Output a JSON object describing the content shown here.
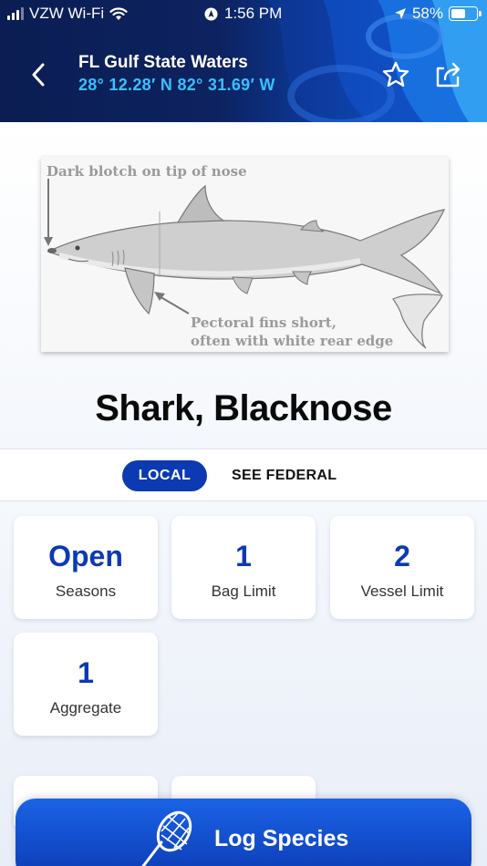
{
  "status_bar": {
    "carrier": "VZW Wi-Fi",
    "time": "1:56 PM",
    "battery": "58%",
    "battery_level": 0.58,
    "icons": [
      "signal-icon",
      "wifi-icon",
      "location-circle-icon",
      "location-arrow-icon",
      "battery-icon"
    ]
  },
  "header": {
    "title": "FL Gulf State Waters",
    "coordinates": "28° 12.28′ N 82° 31.69′ W",
    "icons": [
      "back-icon",
      "star-icon",
      "share-icon"
    ]
  },
  "species_image": {
    "label_nose": "Dark blotch on tip of nose",
    "label_fins_line1": "Pectoral fins short,",
    "label_fins_line2": "often with white rear edge"
  },
  "species": {
    "name": "Shark, Blacknose"
  },
  "tabs": {
    "local": "LOCAL",
    "federal": "SEE FEDERAL",
    "active": "LOCAL"
  },
  "cards": [
    {
      "value": "Open",
      "label": "Seasons"
    },
    {
      "value": "1",
      "label": "Bag Limit"
    },
    {
      "value": "2",
      "label": "Vessel Limit"
    },
    {
      "value": "1",
      "label": "Aggregate"
    }
  ],
  "log_button": {
    "label": "Log Species",
    "icon": "fishing-net-icon"
  },
  "colors": {
    "accent": "#0c3ab3",
    "coordinates": "#39c0ff",
    "header_dark": "#0b1d52"
  }
}
